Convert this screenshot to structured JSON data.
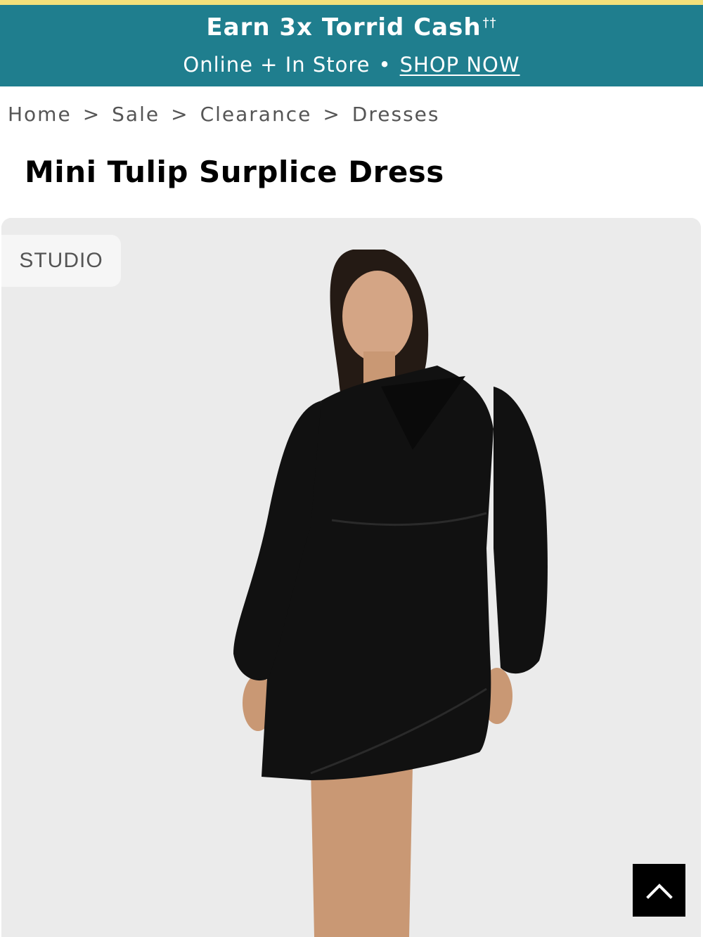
{
  "promo": {
    "title": "Earn 3x Torrid Cash",
    "title_mark": "††",
    "line_text": "Online + In Store",
    "separator": "•",
    "cta": "SHOP NOW"
  },
  "breadcrumb": {
    "items": [
      "Home",
      "Sale",
      "Clearance",
      "Dresses"
    ],
    "separator": ">"
  },
  "product": {
    "title": "Mini Tulip Surplice Dress",
    "badge": "STUDIO",
    "image_alt": "model wearing black long-sleeve mini wrap dress"
  },
  "icons": {
    "back_to_top": "chevron-up-icon"
  },
  "colors": {
    "promo_bg": "#1f7e8e",
    "top_stripe": "#f3e07a",
    "image_bg": "#ebebeb",
    "dress": "#111111"
  }
}
